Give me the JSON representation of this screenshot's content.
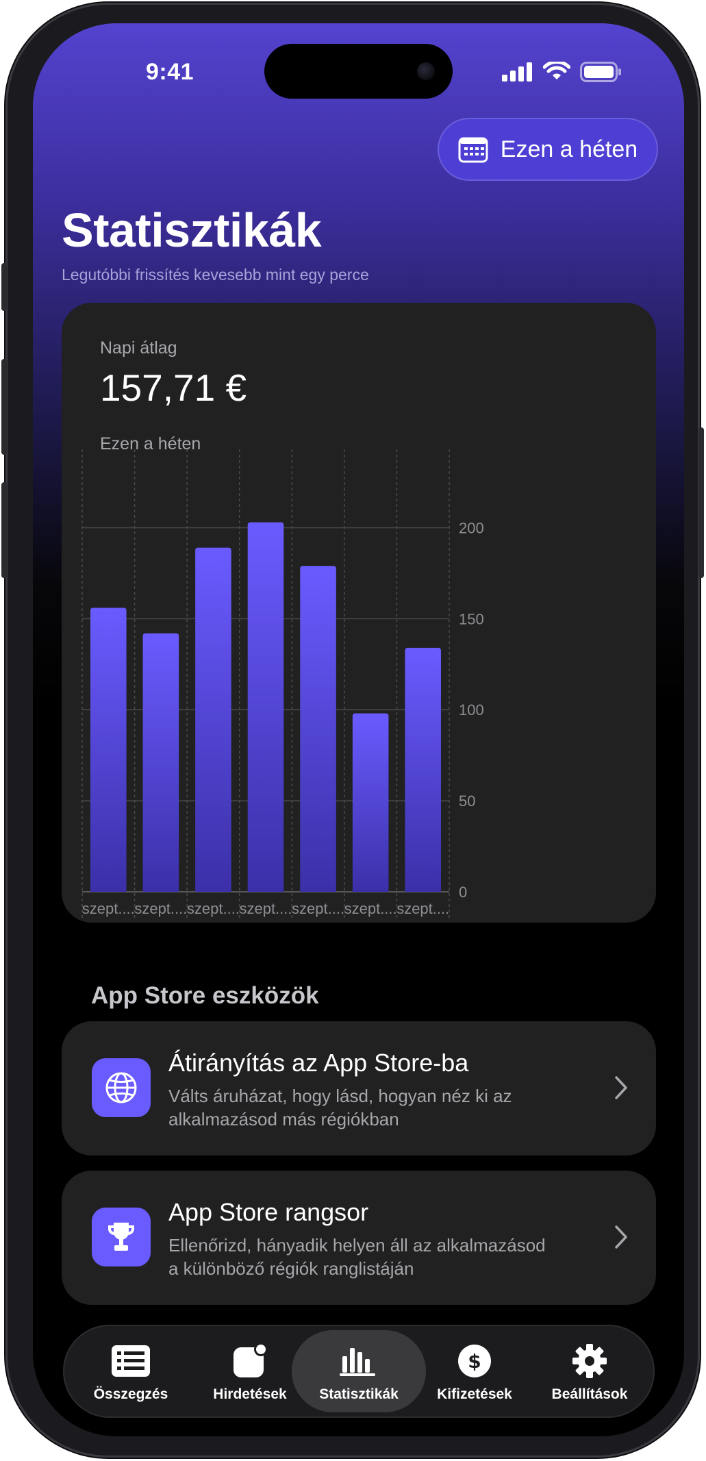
{
  "status_bar": {
    "time": "9:41"
  },
  "header": {
    "period_button_label": "Ezen a héten",
    "title": "Statisztikák",
    "subtitle": "Legutóbbi frissítés kevesebb mint egy perce"
  },
  "summary": {
    "label": "Napi átlag",
    "value": "157,71 €",
    "period": "Ezen a héten"
  },
  "chart_data": {
    "type": "bar",
    "categories": [
      "szept....",
      "szept....",
      "szept....",
      "szept....",
      "szept....",
      "szept....",
      "szept...."
    ],
    "values": [
      156,
      142,
      189,
      203,
      179,
      98,
      134
    ],
    "yticks": [
      0,
      50,
      100,
      150,
      200
    ],
    "ylim": [
      0,
      225
    ],
    "y_axis_side": "right",
    "grid": true,
    "bar_color_top": "#6a5bff",
    "bar_color_bottom": "#3b30a8"
  },
  "tools": {
    "section_title": "App Store eszközök",
    "items": [
      {
        "icon": "globe-icon",
        "title": "Átirányítás az App Store-ba",
        "description": "Válts áruházat, hogy lásd, hogyan néz ki az alkalmazásod más régiókban"
      },
      {
        "icon": "trophy-icon",
        "title": "App Store rangsor",
        "description": "Ellenőrizd, hányadik helyen áll az alkalmazásod a különböző régiók ranglistáján"
      }
    ]
  },
  "tabbar": {
    "items": [
      {
        "label": "Összegzés",
        "icon": "list-icon",
        "active": false
      },
      {
        "label": "Hirdetések",
        "icon": "app-badge-icon",
        "active": false
      },
      {
        "label": "Statisztikák",
        "icon": "bar-chart-icon",
        "active": true
      },
      {
        "label": "Kifizetések",
        "icon": "dollar-icon",
        "active": false
      },
      {
        "label": "Beállítások",
        "icon": "gear-icon",
        "active": false
      }
    ]
  },
  "colors": {
    "accent": "#6a5bff",
    "header_gradient_top": "#5343cf",
    "card_background": "#212121"
  }
}
